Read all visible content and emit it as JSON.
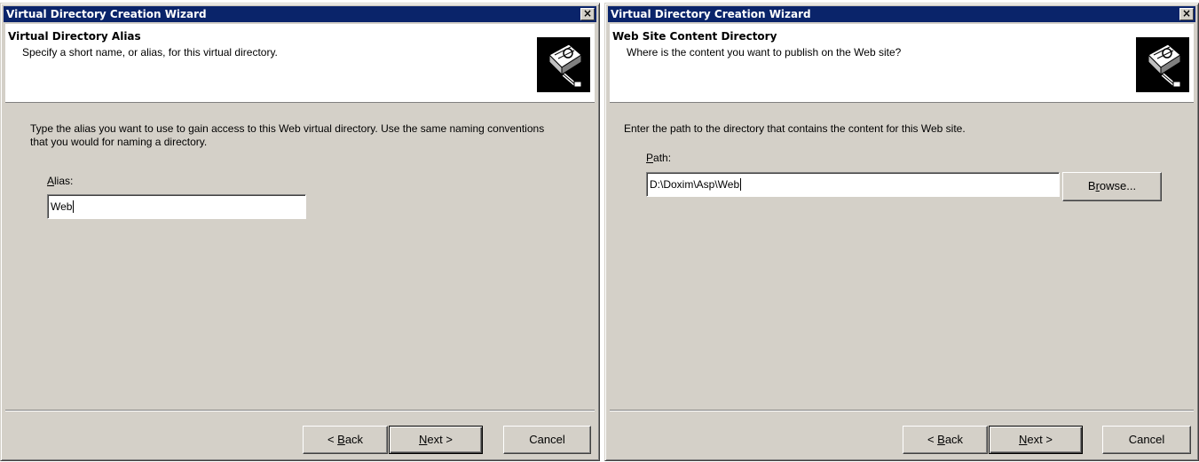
{
  "windows": [
    {
      "title": "Virtual Directory Creation Wizard",
      "close_label": "×",
      "header": {
        "title": "Virtual Directory Alias",
        "subtitle": "Specify a short name, or alias, for this virtual directory."
      },
      "instructions": "Type the alias you want to use to gain access to this Web virtual directory. Use the same naming conventions that you would for naming a directory.",
      "field": {
        "label_key": "A",
        "label_rest": "lias:",
        "value": "Web"
      },
      "buttons": {
        "back": {
          "pre": "< ",
          "key": "B",
          "rest": "ack"
        },
        "next": {
          "key": "N",
          "rest": "ext >"
        },
        "cancel": "Cancel"
      }
    },
    {
      "title": "Virtual Directory Creation Wizard",
      "close_label": "×",
      "header": {
        "title": "Web Site Content Directory",
        "subtitle": "Where is the content you want to publish on the Web site?"
      },
      "instructions": "Enter the path to the directory that contains the content for this Web site.",
      "field": {
        "label_key": "P",
        "label_rest": "ath:",
        "value": "D:\\Doxim\\Asp\\Web"
      },
      "browse": {
        "key": "r",
        "pre": "B",
        "rest": "owse..."
      },
      "buttons": {
        "back": {
          "pre": "< ",
          "key": "B",
          "rest": "ack"
        },
        "next": {
          "key": "N",
          "rest": "ext >"
        },
        "cancel": "Cancel"
      }
    }
  ],
  "icon": "wizard-book-icon"
}
